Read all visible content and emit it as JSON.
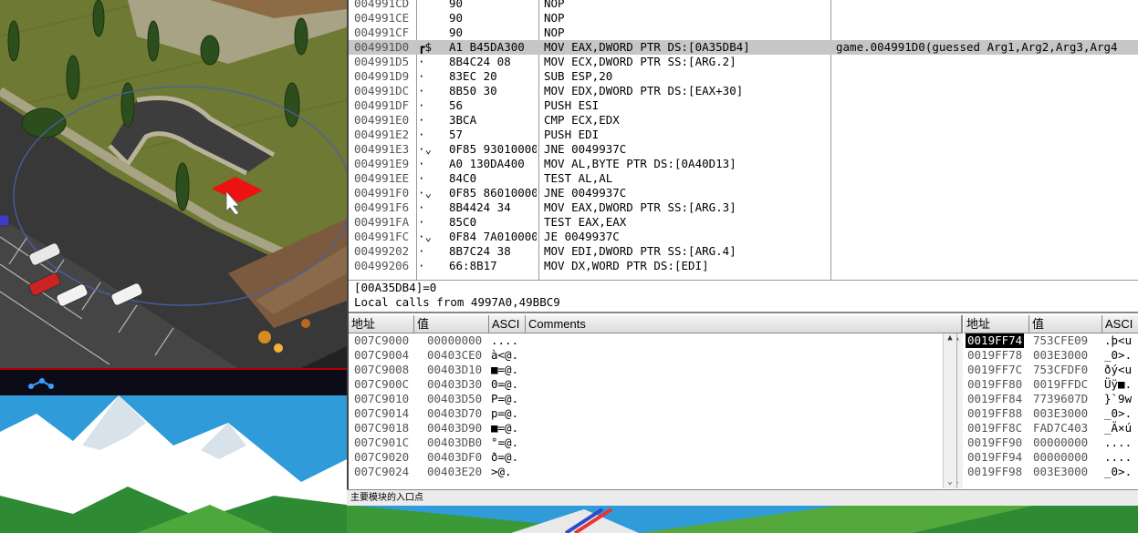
{
  "disassembly": [
    {
      "addr": "004991CD",
      "mark": "",
      "hex": "90",
      "ins": "NOP",
      "cmt": ""
    },
    {
      "addr": "004991CE",
      "mark": "",
      "hex": "90",
      "ins": "NOP",
      "cmt": ""
    },
    {
      "addr": "004991CF",
      "mark": "",
      "hex": "90",
      "ins": "NOP",
      "cmt": ""
    },
    {
      "addr": "004991D0",
      "mark": "┏$",
      "hex": "A1 B45DA300",
      "ins": "MOV EAX,DWORD PTR DS:[0A35DB4]",
      "cmt": "game.004991D0(guessed Arg1,Arg2,Arg3,Arg4",
      "selected": true
    },
    {
      "addr": "004991D5",
      "mark": "·",
      "hex": "8B4C24 08",
      "ins": "MOV ECX,DWORD PTR SS:[ARG.2]",
      "cmt": ""
    },
    {
      "addr": "004991D9",
      "mark": "·",
      "hex": "83EC 20",
      "ins": "SUB ESP,20",
      "cmt": ""
    },
    {
      "addr": "004991DC",
      "mark": "·",
      "hex": "8B50 30",
      "ins": "MOV EDX,DWORD PTR DS:[EAX+30]",
      "cmt": ""
    },
    {
      "addr": "004991DF",
      "mark": "·",
      "hex": "56",
      "ins": "PUSH ESI",
      "cmt": ""
    },
    {
      "addr": "004991E0",
      "mark": "·",
      "hex": "3BCA",
      "ins": "CMP ECX,EDX",
      "cmt": ""
    },
    {
      "addr": "004991E2",
      "mark": "·",
      "hex": "57",
      "ins": "PUSH EDI",
      "cmt": ""
    },
    {
      "addr": "004991E3",
      "mark": "·⌄",
      "hex": "0F85 93010000",
      "ins": "JNE 0049937C",
      "cmt": ""
    },
    {
      "addr": "004991E9",
      "mark": "·",
      "hex": "A0 130DA400",
      "ins": "MOV AL,BYTE PTR DS:[0A40D13]",
      "cmt": ""
    },
    {
      "addr": "004991EE",
      "mark": "·",
      "hex": "84C0",
      "ins": "TEST AL,AL",
      "cmt": ""
    },
    {
      "addr": "004991F0",
      "mark": "·⌄",
      "hex": "0F85 86010000",
      "ins": "JNE 0049937C",
      "cmt": ""
    },
    {
      "addr": "004991F6",
      "mark": "·",
      "hex": "8B4424 34",
      "ins": "MOV EAX,DWORD PTR SS:[ARG.3]",
      "cmt": ""
    },
    {
      "addr": "004991FA",
      "mark": "·",
      "hex": "85C0",
      "ins": "TEST EAX,EAX",
      "cmt": ""
    },
    {
      "addr": "004991FC",
      "mark": "·⌄",
      "hex": "0F84 7A010000",
      "ins": "JE 0049937C",
      "cmt": ""
    },
    {
      "addr": "00499202",
      "mark": "·",
      "hex": "8B7C24 38",
      "ins": "MOV EDI,DWORD PTR SS:[ARG.4]",
      "cmt": ""
    },
    {
      "addr": "00499206",
      "mark": "·",
      "hex": "66:8B17",
      "ins": "MOV DX,WORD PTR DS:[EDI]",
      "cmt": ""
    }
  ],
  "info": {
    "line1": "[00A35DB4]=0",
    "line2": "Local calls from 4997A0,49BBC9"
  },
  "dump": {
    "headers": [
      "地址",
      "值",
      "ASCI",
      "Comments"
    ],
    "rows": [
      [
        "007C9000",
        "00000000",
        "...."
      ],
      [
        "007C9004",
        "00403CE0",
        "à<@."
      ],
      [
        "007C9008",
        "00403D10",
        "■=@."
      ],
      [
        "007C900C",
        "00403D30",
        "0=@."
      ],
      [
        "007C9010",
        "00403D50",
        "P=@."
      ],
      [
        "007C9014",
        "00403D70",
        "p=@."
      ],
      [
        "007C9018",
        "00403D90",
        "■=@."
      ],
      [
        "007C901C",
        "00403DB0",
        "°=@."
      ],
      [
        "007C9020",
        "00403DF0",
        "ð=@."
      ],
      [
        "007C9024",
        "00403E20",
        " >@."
      ]
    ]
  },
  "stack": {
    "headers": [
      "地址",
      "值",
      "ASCI"
    ],
    "rows": [
      [
        "0019FF74",
        "753CFE09",
        ".þ<u"
      ],
      [
        "0019FF78",
        "003E3000",
        "_0>."
      ],
      [
        "0019FF7C",
        "753CFDF0",
        "ðý<u"
      ],
      [
        "0019FF80",
        "0019FFDC",
        "Üÿ■."
      ],
      [
        "0019FF84",
        "7739607D",
        "}`9w"
      ],
      [
        "0019FF88",
        "003E3000",
        "_0>."
      ],
      [
        "0019FF8C",
        "FAD7C403",
        "_Ä×ú"
      ],
      [
        "0019FF90",
        "00000000",
        "...."
      ],
      [
        "0019FF94",
        "00000000",
        "...."
      ],
      [
        "0019FF98",
        "003E3000",
        "_0>."
      ]
    ]
  },
  "status": "主要模块的入口点",
  "icons": {
    "scroll_up": "▲",
    "scroll_down": "⌄"
  },
  "colors": {
    "selected_row": "#c6c6c6",
    "grass": "#6f7a35",
    "asphalt": "#3a3a3a",
    "red_tile": "#e11"
  }
}
